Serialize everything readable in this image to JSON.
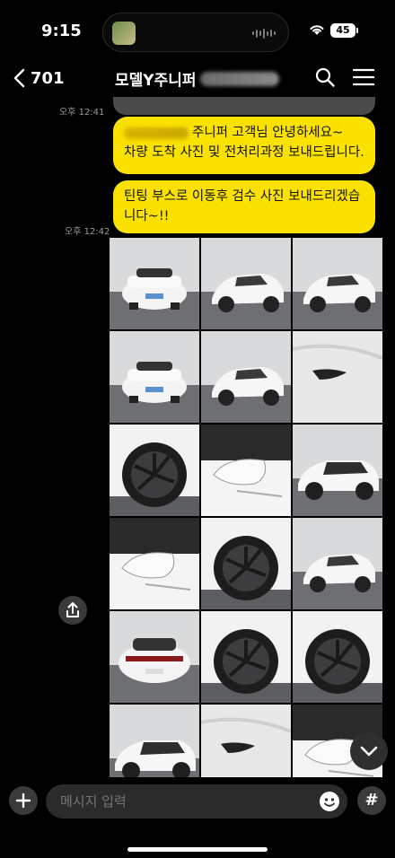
{
  "status_bar": {
    "time": "9:15",
    "battery": "45"
  },
  "header": {
    "back_count": "701",
    "title": "모델Y주니퍼"
  },
  "messages": [
    {
      "time": "오후 12:41"
    },
    {
      "time": "",
      "text_line1": "주니퍼 고객님 안녕하세요~",
      "text_line2": "차량 도착 사진 및 전처리과정 보내드립니다."
    },
    {
      "time": "오후 12:42",
      "text_line1": "틴팅 부스로 이동후 검수 사진 보내드리겠습",
      "text_line2": "니다~!!"
    }
  ],
  "photos": [
    {
      "view": "front"
    },
    {
      "view": "front-left"
    },
    {
      "view": "front-left"
    },
    {
      "view": "front"
    },
    {
      "view": "front-left"
    },
    {
      "view": "door-handle"
    },
    {
      "view": "wheel"
    },
    {
      "view": "mirror"
    },
    {
      "view": "side"
    },
    {
      "view": "mirror"
    },
    {
      "view": "rear-wheel"
    },
    {
      "view": "rear-left"
    },
    {
      "view": "rear"
    },
    {
      "view": "wheel"
    },
    {
      "view": "wheel"
    },
    {
      "view": "side"
    },
    {
      "view": "door-handle"
    },
    {
      "view": "mirror"
    }
  ],
  "input": {
    "placeholder": "메시지 입력"
  },
  "icons": {
    "back": "chevron-left-icon",
    "search": "search-icon",
    "menu": "hamburger-menu-icon",
    "share": "share-icon",
    "scroll": "chevron-down-icon",
    "plus": "plus-icon",
    "emoji": "emoji-icon",
    "hash": "#"
  },
  "colors": {
    "bubble": "#fae100",
    "background": "#000000"
  }
}
